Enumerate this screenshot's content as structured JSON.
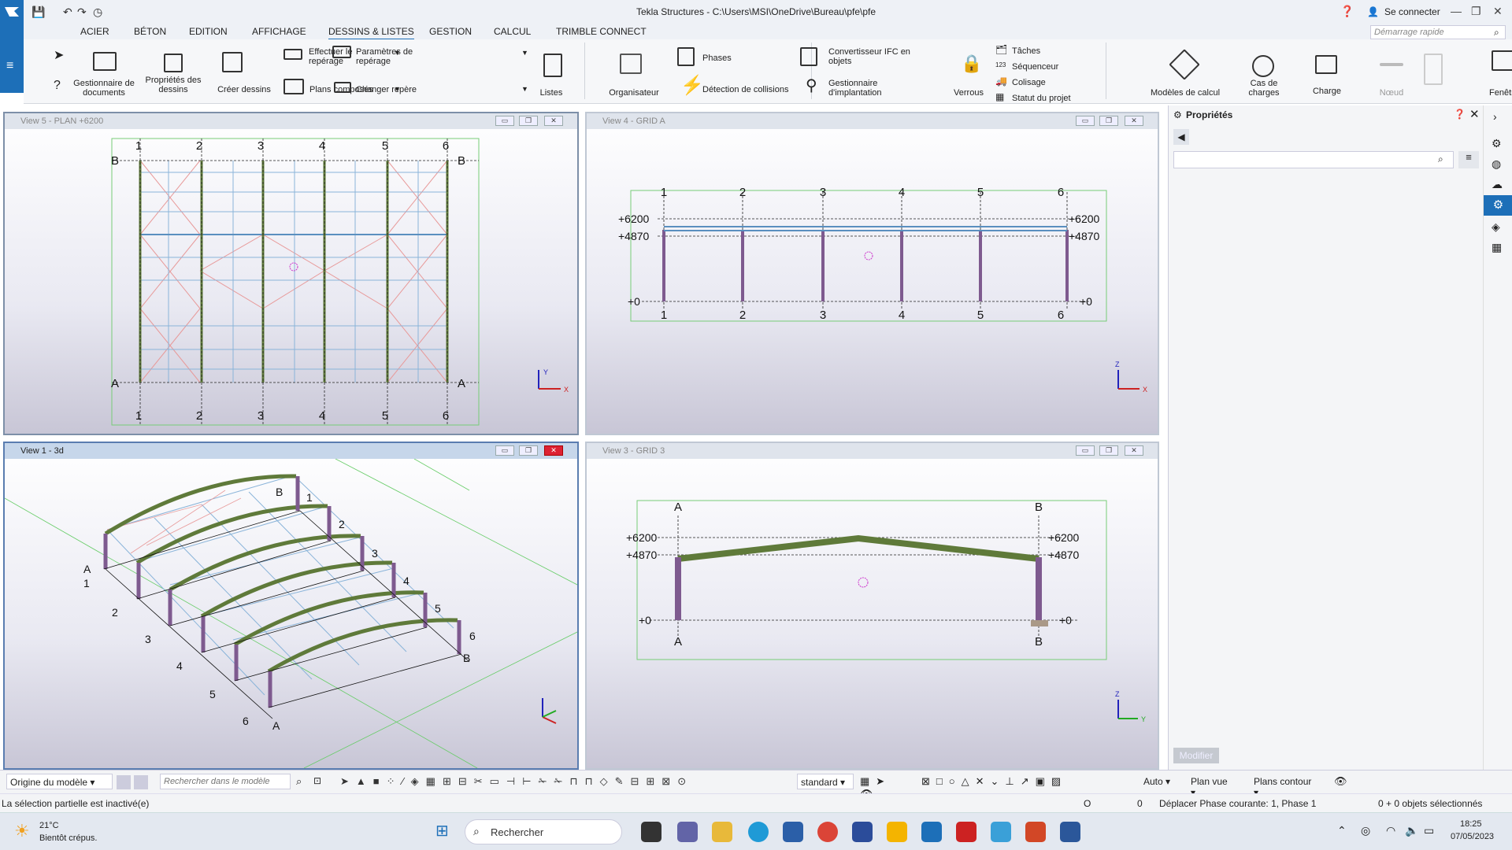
{
  "window": {
    "title": "Tekla Structures - C:\\Users\\MSI\\OneDrive\\Bureau\\pfe\\pfe",
    "signin": "Se connecter"
  },
  "menu": {
    "items": [
      "ACIER",
      "BÉTON",
      "EDITION",
      "AFFICHAGE",
      "DESSINS & LISTES",
      "GESTION",
      "CALCUL",
      "TRIMBLE CONNECT"
    ],
    "active": "DESSINS & LISTES",
    "quick_search": "Démarrage rapide"
  },
  "ribbon": {
    "doc_manager": "Gestionnaire de documents",
    "drawing_props": "Propriétés des dessins",
    "create_drawings": "Créer dessins",
    "numbering": "Effectuer le repérage",
    "numbering_settings": "Paramètres de repérage",
    "composite_plans": "Plans composés",
    "change_mark": "Changer repère",
    "lists": "Listes",
    "organizer": "Organisateur",
    "phases": "Phases",
    "clash": "Détection de collisions",
    "ifc": "Convertisseur IFC en objets",
    "layout_manager": "Gestionnaire d'implantation",
    "locks": "Verrous",
    "tasks": "Tâches",
    "sequencer": "Séquenceur",
    "packaging": "Colisage",
    "project_status": "Statut du projet",
    "analysis_models": "Modèles de calcul",
    "load_cases": "Cas de charges",
    "load": "Charge",
    "node": "Nœud",
    "window": "Fenêtre"
  },
  "views": {
    "plan": {
      "title": "View 5 - PLAN +6200",
      "grids": [
        "1",
        "2",
        "3",
        "4",
        "5",
        "6"
      ],
      "rows": [
        "A",
        "B"
      ]
    },
    "grida": {
      "title": "View 4 - GRID A",
      "grids": [
        "1",
        "2",
        "3",
        "4",
        "5",
        "6"
      ],
      "levels": [
        "+6200",
        "+4870",
        "+0"
      ]
    },
    "threed": {
      "title": "View 1 - 3d",
      "grids": [
        "1",
        "2",
        "3",
        "4",
        "5",
        "6"
      ],
      "rows": [
        "A",
        "B"
      ]
    },
    "grid3": {
      "title": "View 3 - GRID 3",
      "rows": [
        "A",
        "B"
      ],
      "levels": [
        "+6200",
        "+4870",
        "+0"
      ]
    }
  },
  "properties": {
    "title": "Propriétés",
    "modify": "Modifier"
  },
  "toolbar": {
    "origin": "Origine du modèle",
    "search_placeholder": "Rechercher dans le modèle",
    "standard": "standard",
    "auto": "Auto",
    "plan_view": "Plan vue",
    "contour_plans": "Plans contour"
  },
  "status": {
    "left": "La sélection partielle est inactivé(e)",
    "o": "O",
    "zero": "0",
    "message": "Déplacer Phase courante: 1, Phase 1",
    "selected": "0 + 0 objets sélectionnés"
  },
  "taskbar": {
    "temp": "21°C",
    "weather": "Bientôt crépus.",
    "search": "Rechercher",
    "time": "18:25",
    "date": "07/05/2023"
  },
  "colors": {
    "accent": "#1d6fb8",
    "steel_purple": "#7e5a8f",
    "beam_green": "#5f7a3a",
    "grid_blue": "#8ab4d9",
    "bracing_red": "#e68a8a"
  }
}
